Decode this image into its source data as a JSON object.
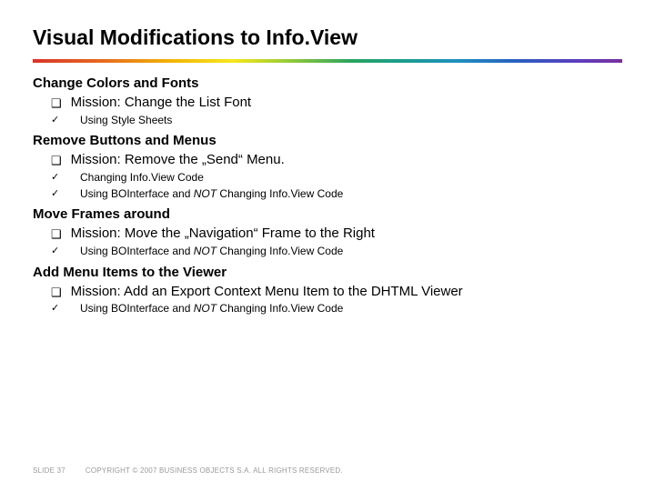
{
  "title": "Visual Modifications to Info.View",
  "sections": [
    {
      "heading": "Change Colors and Fonts",
      "mission": "Mission: Change the List Font",
      "subs": [
        {
          "text": "Using Style Sheets",
          "italicPart": ""
        }
      ]
    },
    {
      "heading": "Remove Buttons and Menus",
      "mission": "Mission: Remove the „Send“ Menu.",
      "subs": [
        {
          "text": "Changing Info.View Code",
          "italicPart": ""
        },
        {
          "text": "Using BOInterface and ",
          "italicPart": "NOT",
          "tail": " Changing Info.View Code"
        }
      ]
    },
    {
      "heading": "Move Frames around",
      "mission": "Mission: Move the „Navigation“ Frame to the Right",
      "subs": [
        {
          "text": "Using BOInterface and ",
          "italicPart": "NOT",
          "tail": " Changing Info.View Code"
        }
      ]
    },
    {
      "heading": "Add Menu Items to the Viewer",
      "mission": "Mission: Add an Export Context Menu Item to the DHTML Viewer",
      "subs": [
        {
          "text": "Using BOInterface and ",
          "italicPart": "NOT",
          "tail": " Changing Info.View Code"
        }
      ]
    }
  ],
  "footer": {
    "slide": "SLIDE 37",
    "copyright": "COPYRIGHT © 2007 BUSINESS OBJECTS S.A.  ALL RIGHTS RESERVED."
  },
  "glyphs": {
    "box": "❑",
    "check": "✓"
  }
}
